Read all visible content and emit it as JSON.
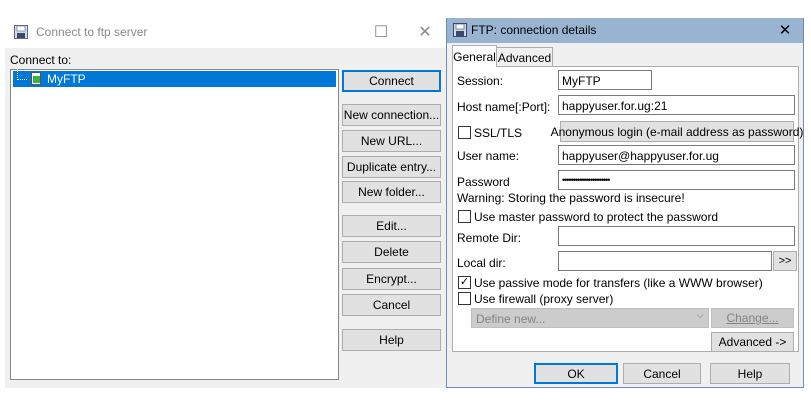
{
  "connect_window": {
    "title": "Connect to ftp server",
    "connect_to_label": "Connect to:",
    "tree_item": "MyFTP",
    "buttons": {
      "connect": "Connect",
      "new_connection": "New connection...",
      "new_url": "New URL...",
      "duplicate_entry": "Duplicate entry...",
      "new_folder": "New folder...",
      "edit": "Edit...",
      "delete": "Delete",
      "encrypt": "Encrypt...",
      "cancel": "Cancel",
      "help": "Help"
    }
  },
  "details_window": {
    "title": "FTP: connection details",
    "tabs": [
      "General",
      "Advanced"
    ],
    "session_label": "Session:",
    "session_value": "MyFTP",
    "host_label": "Host name[:Port]:",
    "host_value": "happyuser.for.ug:21",
    "ssl_label": "SSL/TLS",
    "anonymous_button": "Anonymous login (e-mail address as password)",
    "user_label": "User name:",
    "user_value": "happyuser@happyuser.for.ug",
    "password_label": "Password",
    "password_value": "••••••••••••••••••••••",
    "warning": "Warning: Storing the password is insecure!",
    "master_password_label": "Use master password to protect the password",
    "remote_dir_label": "Remote Dir:",
    "remote_dir_value": "",
    "local_dir_label": "Local dir:",
    "local_dir_value": "",
    "browse_button": ">>",
    "passive_mode_label": "Use passive mode for transfers (like a WWW browser)",
    "passive_mode_checked": true,
    "firewall_label": "Use firewall (proxy server)",
    "firewall_checked": false,
    "firewall_select": "Define new...",
    "change_button": "Change...",
    "advanced_button": "Advanced ->",
    "ok_button": "OK",
    "cancel_button": "Cancel",
    "help_button": "Help"
  },
  "colors": {
    "accent": "#0078d7",
    "titlebar_active": "#99b4d1",
    "selection": "#0078d7",
    "window_bg": "#f0f0f0"
  }
}
